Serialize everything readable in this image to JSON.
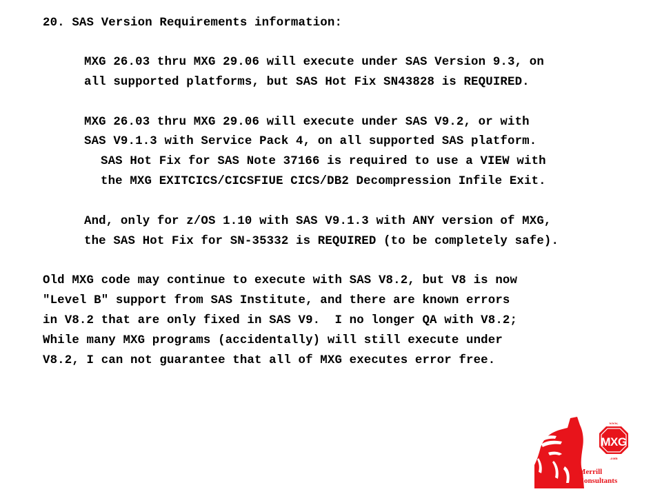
{
  "heading": "20. SAS Version Requirements information:",
  "sections": [
    {
      "indent": 1,
      "lines": [
        "MXG 26.03 thru MXG 29.06 will execute under SAS Version 9.3, on",
        "all supported platforms, but SAS Hot Fix SN43828 is REQUIRED."
      ]
    },
    {
      "indent": 1,
      "lines": [
        "MXG 26.03 thru MXG 29.06 will execute under SAS V9.2, or with",
        "SAS V9.1.3 with Service Pack 4, on all supported SAS platform."
      ]
    },
    {
      "indent": 2,
      "lines": [
        "SAS Hot Fix for SAS Note 37166 is required to use a VIEW with",
        "the MXG EXITCICS/CICSFIUE CICS/DB2 Decompression Infile Exit."
      ]
    },
    {
      "indent": 1,
      "lines": [
        "And, only for z/OS 1.10 with SAS V9.1.3 with ANY version of MXG,",
        "the SAS Hot Fix for SN-35332 is REQUIRED (to be completely safe)."
      ]
    },
    {
      "indent": 0,
      "lines": [
        "Old MXG code may continue to execute with SAS V8.2, but V8 is now",
        "\"Level B\" support from SAS Institute, and there are known errors",
        "in V8.2 that are only fixed in SAS V9.  I no longer QA with V8.2;",
        "While many MXG programs (accidentally) will still execute under",
        "V8.2, I can not guarantee that all of MXG executes error free."
      ]
    }
  ],
  "logo": {
    "www": "www.",
    "mark": "MXG",
    "com": ".com",
    "company_line1": "Merrill",
    "company_line2": "Consultants",
    "brand_color": "#e8141b"
  }
}
